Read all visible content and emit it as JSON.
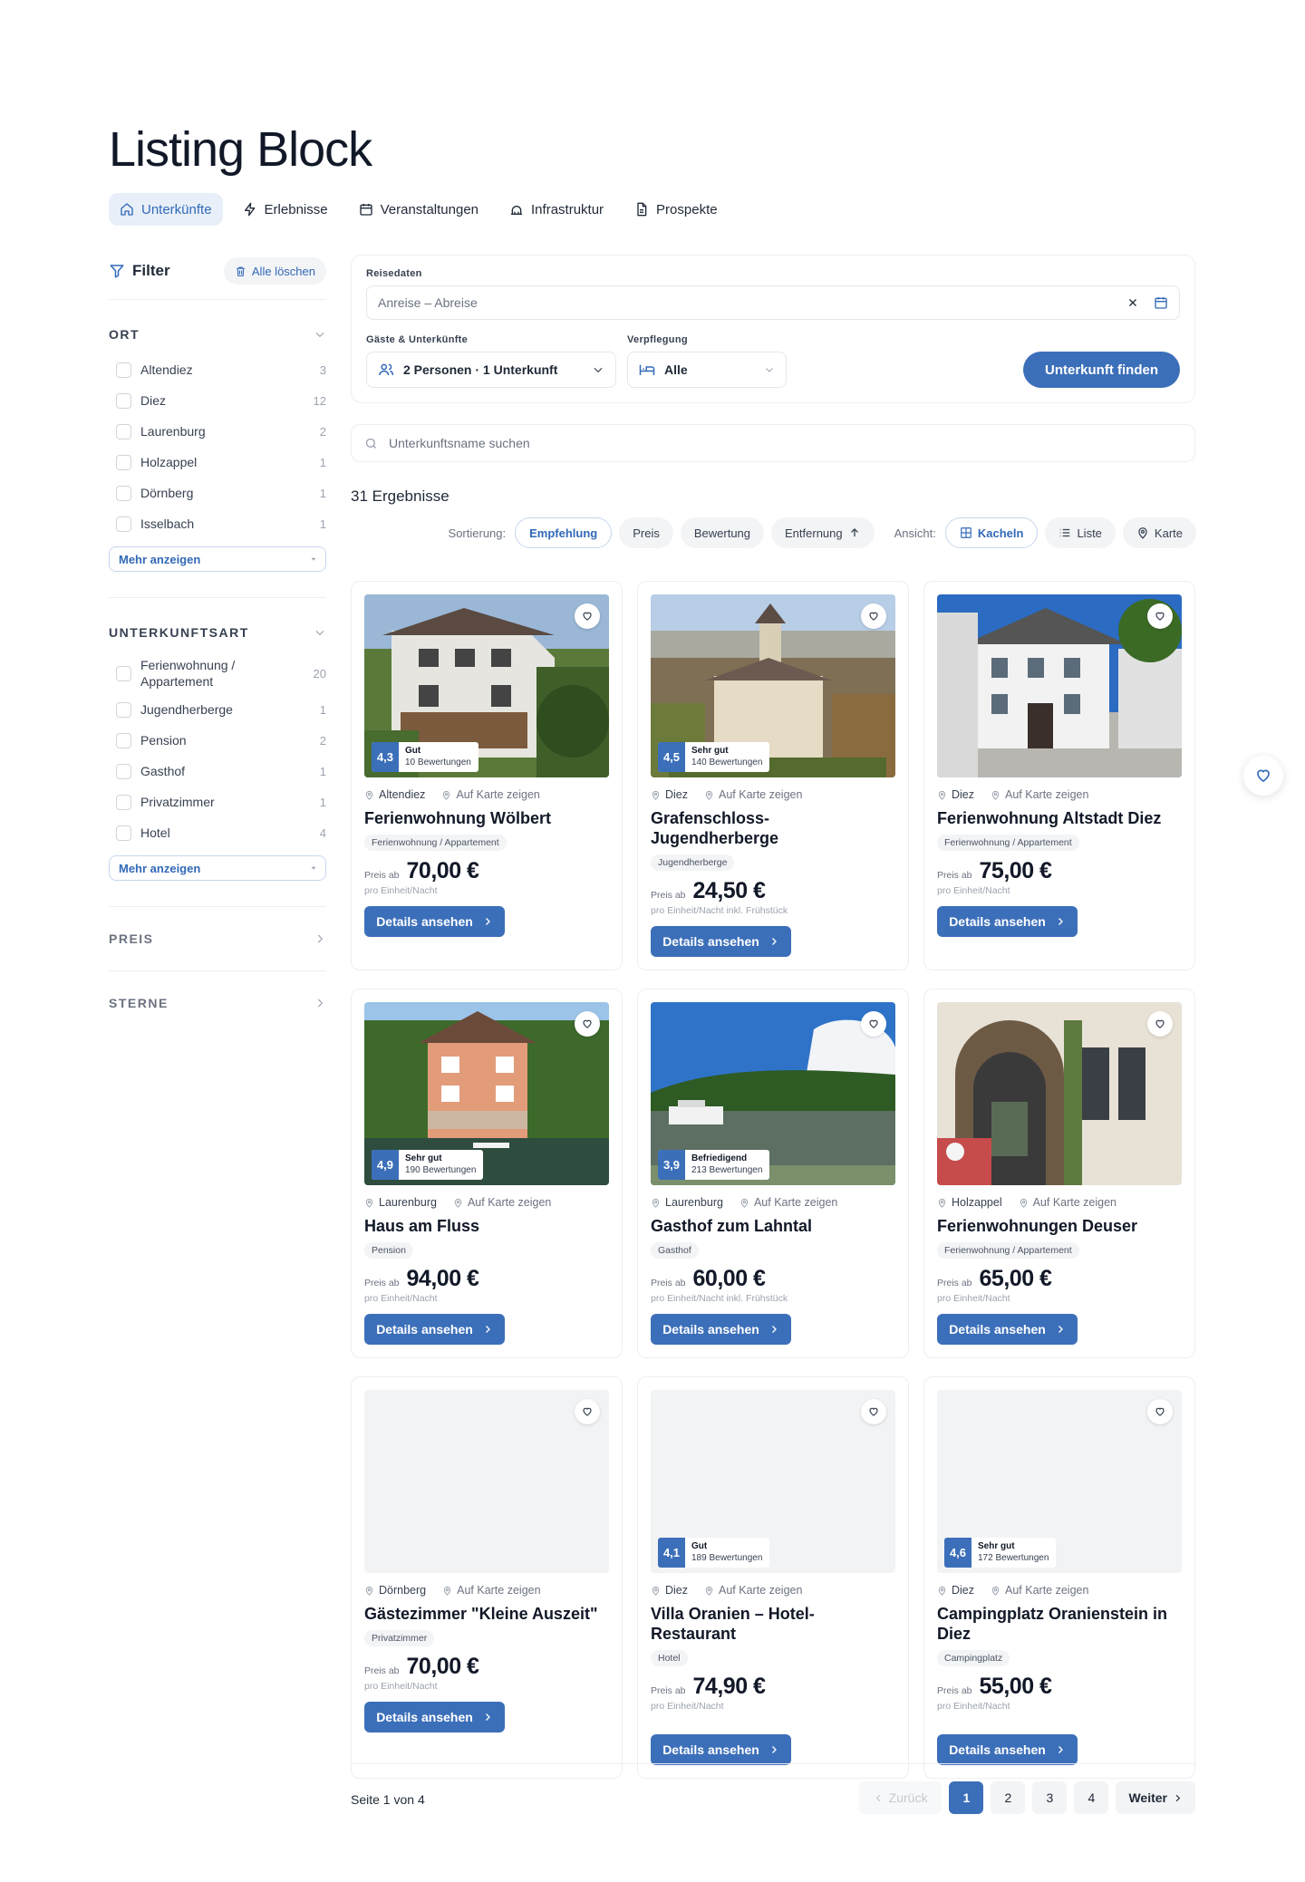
{
  "page": {
    "title": "Listing Block"
  },
  "tabs": [
    {
      "label": "Unterkünfte",
      "active": true
    },
    {
      "label": "Erlebnisse"
    },
    {
      "label": "Veranstaltungen"
    },
    {
      "label": "Infrastruktur"
    },
    {
      "label": "Prospekte"
    }
  ],
  "sidebar": {
    "filter_label": "Filter",
    "clear_label": "Alle löschen",
    "ort": {
      "heading": "ORT",
      "items": [
        {
          "label": "Altendiez",
          "count": "3"
        },
        {
          "label": "Diez",
          "count": "12"
        },
        {
          "label": "Laurenburg",
          "count": "2"
        },
        {
          "label": "Holzappel",
          "count": "1"
        },
        {
          "label": "Dörnberg",
          "count": "1"
        },
        {
          "label": "Isselbach",
          "count": "1"
        }
      ],
      "more_label": "Mehr anzeigen"
    },
    "art": {
      "heading": "UNTERKUNFTSART",
      "items": [
        {
          "label": "Ferienwohnung / Appartement",
          "count": "20"
        },
        {
          "label": "Jugendherberge",
          "count": "1"
        },
        {
          "label": "Pension",
          "count": "2"
        },
        {
          "label": "Gasthof",
          "count": "1"
        },
        {
          "label": "Privatzimmer",
          "count": "1"
        },
        {
          "label": "Hotel",
          "count": "4"
        }
      ],
      "more_label": "Mehr anzeigen"
    },
    "preis_heading": "PREIS",
    "sterne_heading": "STERNE"
  },
  "search": {
    "dates_label": "Reisedaten",
    "dates_placeholder": "Anreise – Abreise",
    "guests_label": "Gäste & Unterkünfte",
    "guests_value": "2 Personen · 1 Unterkunft",
    "board_label": "Verpflegung",
    "board_value": "Alle",
    "find_label": "Unterkunft finden",
    "name_placeholder": "Unterkunftsname suchen"
  },
  "results": {
    "count_label": "31 Ergebnisse"
  },
  "sorting": {
    "label": "Sortierung:",
    "options": [
      "Empfehlung",
      "Preis",
      "Bewertung",
      "Entfernung"
    ],
    "active": "Empfehlung",
    "view_label": "Ansicht:",
    "views": [
      "Kacheln",
      "Liste",
      "Karte"
    ]
  },
  "cards": [
    {
      "city": "Altendiez",
      "map_link": "Auf Karte zeigen",
      "title": "Ferienwohnung Wölbert",
      "tag": "Ferienwohnung / Appartement",
      "price_from": "Preis ab",
      "price": "70,00 €",
      "unit": "pro Einheit/Nacht",
      "button": "Details ansehen",
      "score": "4,3",
      "rating_word": "Gut",
      "reviews": "10 Bewertungen",
      "image": "house"
    },
    {
      "city": "Diez",
      "map_link": "Auf Karte zeigen",
      "title": "Grafenschloss-Jugendherberge",
      "tag": "Jugendherberge",
      "price_from": "Preis ab",
      "price": "24,50 €",
      "unit": "pro Einheit/Nacht inkl. Frühstück",
      "button": "Details ansehen",
      "score": "4,5",
      "rating_word": "Sehr gut",
      "reviews": "140 Bewertungen",
      "image": "castle"
    },
    {
      "city": "Diez",
      "map_link": "Auf Karte zeigen",
      "title": "Ferienwohnung Altstadt Diez",
      "tag": "Ferienwohnung / Appartement",
      "price_from": "Preis ab",
      "price": "75,00 €",
      "unit": "pro Einheit/Nacht",
      "button": "Details ansehen",
      "image": "whitehouse"
    },
    {
      "city": "Laurenburg",
      "map_link": "Auf Karte zeigen",
      "title": "Haus am Fluss",
      "tag": "Pension",
      "price_from": "Preis ab",
      "price": "94,00 €",
      "unit": "pro Einheit/Nacht",
      "button": "Details ansehen",
      "score": "4,9",
      "rating_word": "Sehr gut",
      "reviews": "190 Bewertungen",
      "image": "riverhouse"
    },
    {
      "city": "Laurenburg",
      "map_link": "Auf Karte zeigen",
      "title": "Gasthof zum Lahntal",
      "tag": "Gasthof",
      "price_from": "Preis ab",
      "price": "60,00 €",
      "unit": "pro Einheit/Nacht inkl. Frühstück",
      "button": "Details ansehen",
      "score": "3,9",
      "rating_word": "Befriedigend",
      "reviews": "213 Bewertungen",
      "image": "river"
    },
    {
      "city": "Holzappel",
      "map_link": "Auf Karte zeigen",
      "title": "Ferienwohnungen Deuser",
      "tag": "Ferienwohnung / Appartement",
      "price_from": "Preis ab",
      "price": "65,00 €",
      "unit": "pro Einheit/Nacht",
      "button": "Details ansehen",
      "image": "door"
    },
    {
      "city": "Dörnberg",
      "map_link": "Auf Karte zeigen",
      "title": "Gästezimmer \"Kleine Auszeit\"",
      "tag": "Privatzimmer",
      "price_from": "Preis ab",
      "price": "70,00 €",
      "unit": "pro Einheit/Nacht",
      "button": "Details ansehen",
      "image": "none"
    },
    {
      "city": "Diez",
      "map_link": "Auf Karte zeigen",
      "title": "Villa Oranien – Hotel-Restaurant",
      "tag": "Hotel",
      "price_from": "Preis ab",
      "price": "74,90 €",
      "unit": "pro Einheit/Nacht",
      "button": "Details ansehen",
      "score": "4,1",
      "rating_word": "Gut",
      "reviews": "189 Bewertungen",
      "image": "none"
    },
    {
      "city": "Diez",
      "map_link": "Auf Karte zeigen",
      "title": "Campingplatz Oranienstein in Diez",
      "tag": "Campingplatz",
      "price_from": "Preis ab",
      "price": "55,00 €",
      "unit": "pro Einheit/Nacht",
      "button": "Details ansehen",
      "score": "4,6",
      "rating_word": "Sehr gut",
      "reviews": "172 Bewertungen",
      "image": "none"
    }
  ],
  "pagination": {
    "info": "Seite 1 von 4",
    "prev_label": "Zurück",
    "pages": [
      "1",
      "2",
      "3",
      "4"
    ],
    "current": "1",
    "next_label": "Weiter"
  },
  "colors": {
    "accent": "#3c6fb9",
    "accent_light": "#e8eff8",
    "border": "#eceef1"
  }
}
